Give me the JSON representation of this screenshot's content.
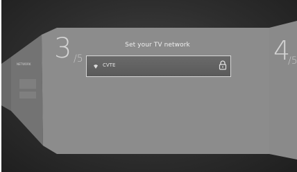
{
  "setup": {
    "title": "Set your TV network",
    "current_step": "3",
    "current_total": "/5",
    "next_step": "4",
    "next_total": "/5"
  },
  "network": {
    "name": "CVTE",
    "icon": "wifi-icon",
    "lock_icon": "lock-icon"
  },
  "left_panel": {
    "label": "NETWORK"
  }
}
